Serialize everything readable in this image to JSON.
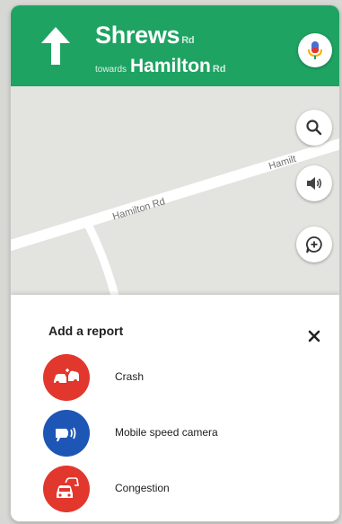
{
  "header": {
    "street_main": "Shrews",
    "street_main_suffix": "Rd",
    "towards": "towards",
    "towards_street": "Hamilton",
    "towards_suffix": "Rd"
  },
  "map": {
    "road_label_1": "Hamilton Rd",
    "road_label_2": "Hamilt"
  },
  "report_sheet": {
    "title": "Add a report",
    "items": [
      {
        "label": "Crash",
        "icon": "crash-icon",
        "color": "#e2372d"
      },
      {
        "label": "Mobile speed camera",
        "icon": "speed-camera-icon",
        "color": "#1e56b6"
      },
      {
        "label": "Congestion",
        "icon": "congestion-icon",
        "color": "#e2372d"
      }
    ]
  },
  "colors": {
    "header_green": "#1ea362",
    "crash_red": "#e2372d",
    "camera_blue": "#1e56b6"
  }
}
